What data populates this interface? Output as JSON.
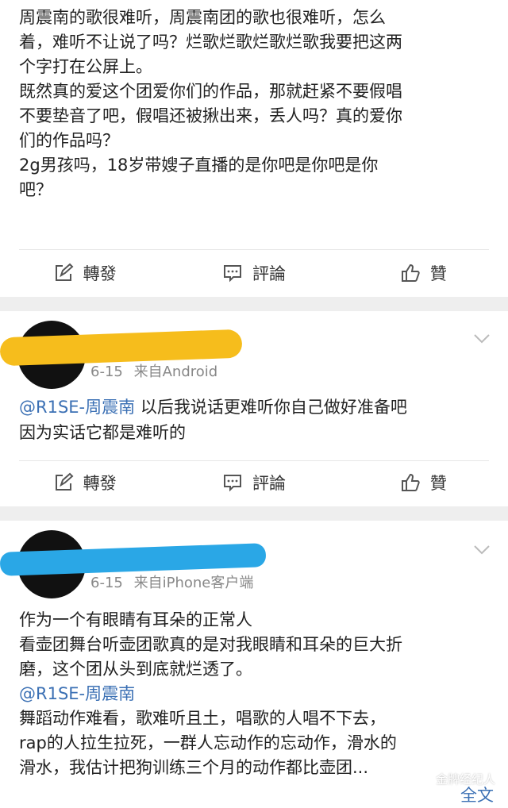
{
  "post1": {
    "lines": [
      "周震南的歌很难听，周震南团的歌也很难听，怎么",
      "着，难听不让说了吗？烂歌烂歌烂歌烂歌我要把这两",
      "个字打在公屏上。",
      "既然真的爱这个团爱你们的作品，那就赶紧不要假唱",
      "不要垫音了吧，假唱还被揪出来，丢人吗？真的爱你",
      "们的作品吗？",
      "2g男孩吗，18岁带嫂子直播的是你吧是你吧是你",
      "吧？"
    ]
  },
  "actions": {
    "repost": "轉發",
    "comment": "評論",
    "like": "贊"
  },
  "comment1": {
    "date": "6-15",
    "source": "来自Android",
    "mention": "@R1SE-周震南",
    "text_after_mention": " 以后我说话更难听你自己做好准备吧",
    "line2": "因为实话它都是难听的"
  },
  "comment2": {
    "date": "6-15",
    "source": "来自iPhone客户端",
    "lines_before": [
      "作为一个有眼睛有耳朵的正常人",
      "看壶团舞台听壶团歌真的是对我眼睛和耳朵的巨大折",
      "磨，这个团从头到底就烂透了。"
    ],
    "mention": "@R1SE-周震南",
    "lines_after": [
      "舞蹈动作难看，歌难听且土，唱歌的人唱不下去，",
      "rap的人拉生拉死，一群人忘动作的忘动作，滑水的",
      "滑水，我估计把狗训练三个月的动作都比壶团..."
    ],
    "full_text_link": "全文"
  },
  "watermark": "金牌经纪人",
  "colors": {
    "link": "#3b70b4",
    "meta": "#888888",
    "separator": "#eeeeee",
    "redact_yellow": "#f6bd1c",
    "redact_blue": "#2aa7e6"
  },
  "icons": {
    "repost": "edit-square-icon",
    "comment": "comment-bubble-icon",
    "like": "thumbs-up-icon",
    "menu": "chevron-down-icon"
  }
}
